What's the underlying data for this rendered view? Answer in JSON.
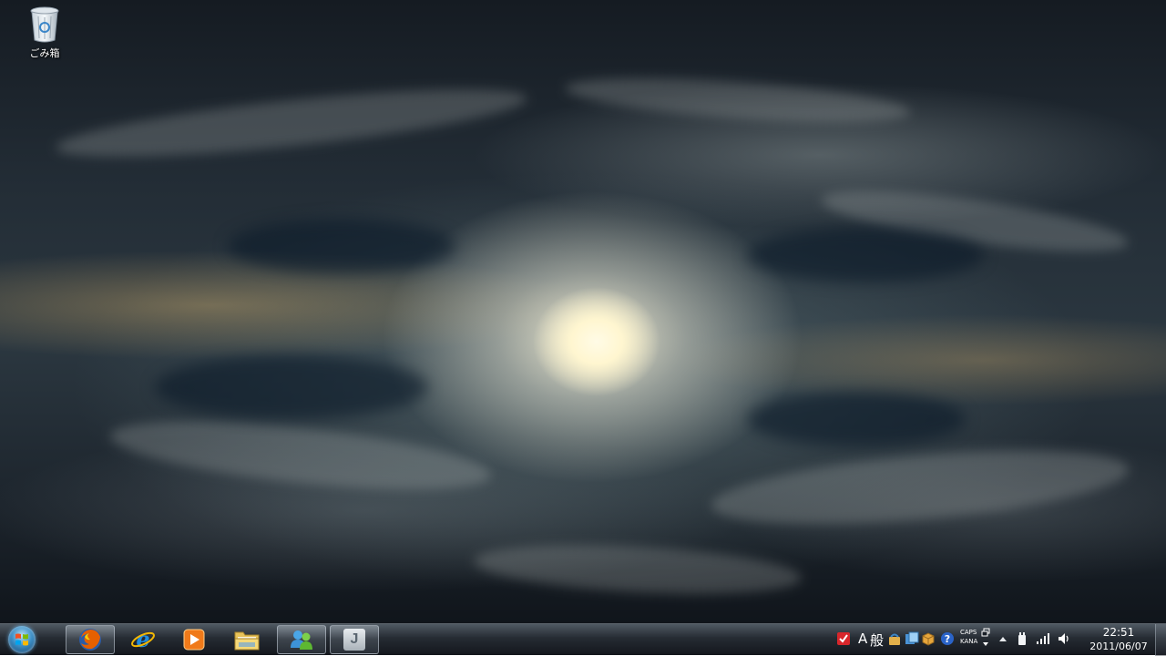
{
  "desktop": {
    "icons": [
      {
        "label": "ごみ箱",
        "icon": "recycle-bin-icon"
      }
    ]
  },
  "taskbar": {
    "start_icon": "windows-start-orb",
    "pinned": [
      {
        "icon": "firefox-icon",
        "active": true
      },
      {
        "icon": "internet-explorer-icon",
        "active": false
      },
      {
        "icon": "media-player-icon",
        "active": false
      },
      {
        "icon": "file-explorer-icon",
        "active": false
      },
      {
        "icon": "messenger-icon",
        "active": true
      },
      {
        "icon": "j-app-icon",
        "label": "J",
        "active": true
      }
    ],
    "tray": {
      "ime_mode": "A",
      "ime_dictionary": "般",
      "caps": "CAPS",
      "kana": "KANA",
      "icons": [
        "checklist-icon",
        "ime-tool-icon",
        "ime-dictionary-icon",
        "ime-package-icon",
        "help-icon",
        "restore-icon",
        "show-hidden-arrow-icon",
        "power-icon",
        "network-signal-icon",
        "volume-icon"
      ]
    },
    "clock": {
      "time": "22:51",
      "date": "2011/06/07"
    }
  },
  "colors": {
    "taskbar_top": "#46505a",
    "taskbar_bottom": "#0f1218",
    "clock_text": "#ffffff"
  }
}
